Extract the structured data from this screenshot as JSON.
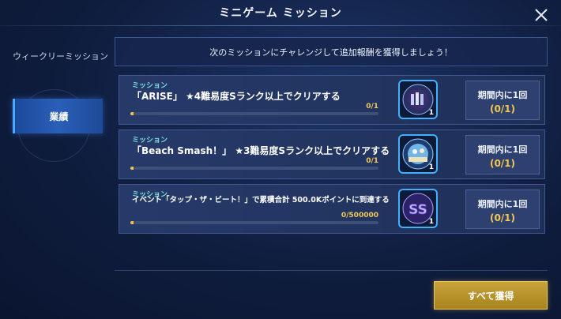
{
  "header": {
    "title": "ミニゲーム ミッション"
  },
  "sidebar": {
    "section_label": "ウィークリーミッション",
    "active_tab": "業績"
  },
  "notice": "次のミッションにチャレンジして追加報酬を獲得しましょう！",
  "missions": [
    {
      "tag": "ミッション",
      "description": "「ARISE」 ★4難易度Sランク以上でクリアする",
      "progress_text": "0/1",
      "progress_fraction": 0.0,
      "reward_icon": "arise-jacket-icon",
      "reward_count": "1",
      "limit": "期間内に1回",
      "completion": "(0/1)"
    },
    {
      "tag": "ミッション",
      "description": "「Beach Smash！」 ★3難易度Sランク以上でクリアする",
      "progress_text": "0/1",
      "progress_fraction": 0.0,
      "reward_icon": "beach-smash-jacket-icon",
      "reward_count": "1",
      "limit": "期間内に1回",
      "completion": "(0/1)"
    },
    {
      "tag": "ミッション",
      "description": "イベント「タップ・ザ・ビート！」で累積合計 500.0Kポイントに到達する",
      "progress_text": "0/500000",
      "progress_fraction": 0.0,
      "reward_icon": "ss-badge-icon",
      "reward_count": "1",
      "limit": "期間内に1回",
      "completion": "(0/1)"
    }
  ],
  "footer": {
    "claim_all_label": "すべて獲得"
  },
  "colors": {
    "accent_gold": "#f4c84e",
    "accent_blue": "#3fb1ff",
    "tag_teal": "#7ee0d8"
  }
}
